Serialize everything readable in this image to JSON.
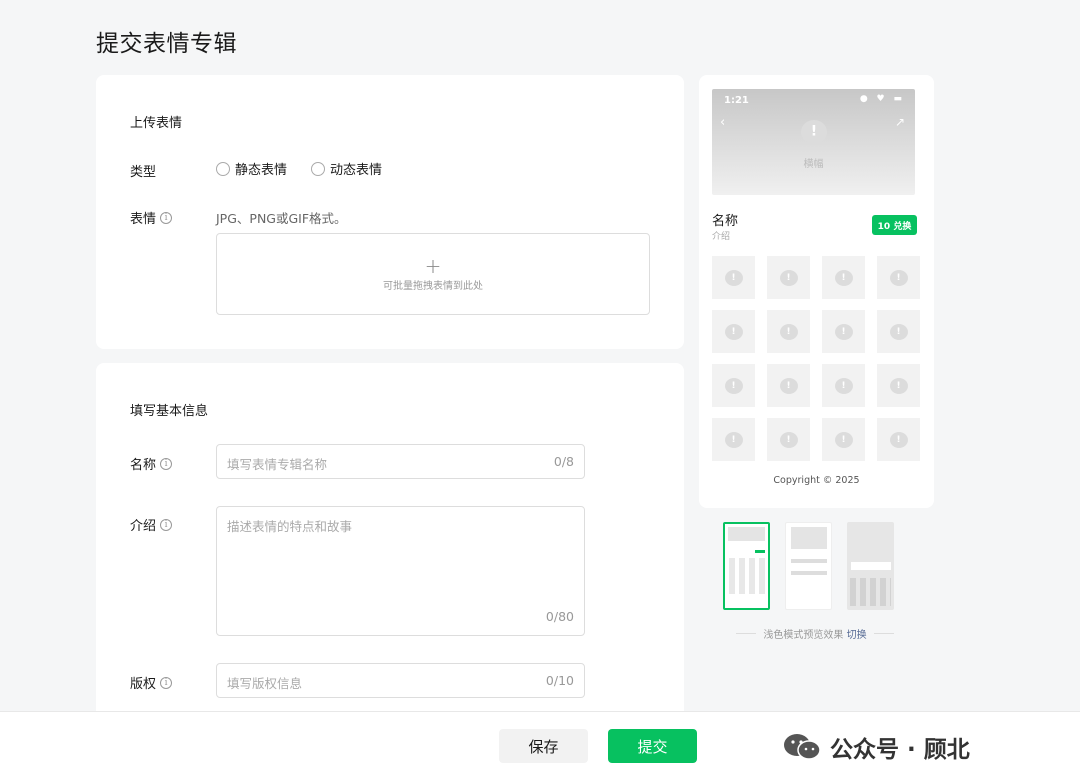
{
  "page": {
    "title": "提交表情专辑"
  },
  "upload": {
    "section_title": "上传表情",
    "type_label": "类型",
    "type_options": [
      "静态表情",
      "动态表情"
    ],
    "emoji_label": "表情",
    "format_hint": "JPG、PNG或GIF格式。",
    "dropzone_plus": "+",
    "dropzone_text": "可批量拖拽表情到此处"
  },
  "info": {
    "section_title": "填写基本信息",
    "name_label": "名称",
    "name_placeholder": "填写表情专辑名称",
    "name_counter": "0/8",
    "intro_label": "介绍",
    "intro_placeholder": "描述表情的特点和故事",
    "intro_counter": "0/80",
    "copyright_label": "版权",
    "copyright_placeholder": "填写版权信息",
    "copyright_counter": "0/10"
  },
  "preview": {
    "time": "1:21",
    "status_icons": "● ♥ ▬",
    "header_label": "横幅",
    "name": "名称",
    "intro": "介绍",
    "badge": "10 兑换",
    "copyright": "Copyright © 2025",
    "mode_text": "浅色模式预览效果",
    "switch_label": "切换"
  },
  "actions": {
    "save": "保存",
    "submit": "提交"
  },
  "watermark": {
    "text": "公众号 · 顾北"
  },
  "colors": {
    "accent": "#07c160",
    "link": "#576b95"
  }
}
